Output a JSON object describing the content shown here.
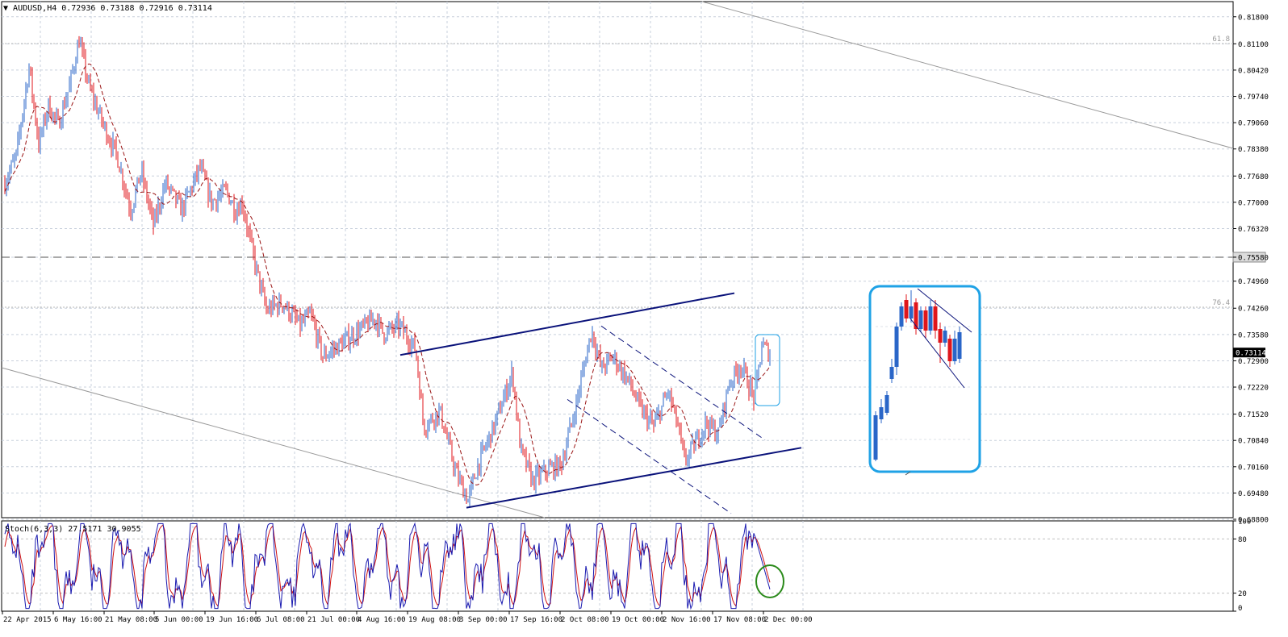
{
  "header": {
    "symbol": "AUDUSD,H4",
    "open": "0.72936",
    "high": "0.73188",
    "low": "0.72916",
    "close": "0.73114"
  },
  "colors": {
    "bull": "#2a66c8",
    "bear": "#e0161b",
    "ma": "#9a1414",
    "channel": "#0a127a",
    "grid": "#c8d0dc",
    "highlight_box": "#1fa2e6",
    "circle": "#2a8a1a",
    "stoch_main": "#1a1ab0",
    "stoch_signal": "#d01010"
  },
  "price_axis": {
    "labels": [
      "0.81800",
      "0.81100",
      "0.80420",
      "0.79740",
      "0.79060",
      "0.78380",
      "0.77680",
      "0.77000",
      "0.76320",
      "0.75580",
      "0.74960",
      "0.74260",
      "0.73580",
      "0.73114",
      "0.72900",
      "0.72220",
      "0.71520",
      "0.70840",
      "0.70160",
      "0.69480",
      "0.68800"
    ],
    "current_price": "0.73114",
    "level_price": "0.75580"
  },
  "fib_labels": [
    "61.8",
    "76.4"
  ],
  "time_axis": [
    "22 Apr 2015",
    "6 May 16:00",
    "21 May 08:00",
    "5 Jun 00:00",
    "19 Jun 16:00",
    "6 Jul 08:00",
    "21 Jul 00:00",
    "4 Aug 16:00",
    "19 Aug 08:00",
    "3 Sep 00:00",
    "17 Sep 16:00",
    "2 Oct 08:00",
    "19 Oct 00:00",
    "2 Nov 16:00",
    "17 Nov 08:00",
    "2 Dec 00:00"
  ],
  "stoch": {
    "label": "Stoch(6,3,3)",
    "main_value": "27.5171",
    "signal_value": "30.9055",
    "scale": [
      "100",
      "80",
      "20",
      "0"
    ]
  },
  "chart_data": {
    "type": "candlestick",
    "symbol": "AUDUSD",
    "timeframe": "H4",
    "ylim": [
      0.688,
      0.8215
    ],
    "key_points": {
      "x": [
        "22 Apr 2015",
        "6 May 16:00",
        "21 May 08:00",
        "5 Jun 00:00",
        "19 Jun 16:00",
        "6 Jul 08:00",
        "21 Jul 00:00",
        "4 Aug 16:00",
        "19 Aug 08:00",
        "3 Sep 00:00",
        "17 Sep 16:00",
        "2 Oct 08:00",
        "19 Oct 00:00",
        "2 Nov 16:00",
        "17 Nov 08:00",
        "2 Dec 00:00"
      ],
      "approx_close": [
        0.778,
        0.79,
        0.778,
        0.771,
        0.77,
        0.752,
        0.734,
        0.735,
        0.721,
        0.695,
        0.707,
        0.728,
        0.722,
        0.705,
        0.717,
        0.731
      ]
    },
    "horizontal_level": 0.7558,
    "channel_upper": [
      [
        0.7305,
        0.7465
      ]
    ],
    "channel_lower": [
      [
        0.691,
        0.7065
      ]
    ]
  }
}
